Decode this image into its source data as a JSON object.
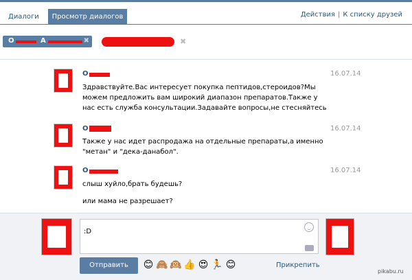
{
  "tabs": {
    "dialogs_label": "Диалоги",
    "view_label": "Просмотр диалогов",
    "actions_label": "Действия",
    "friends_label": "К списку друзей",
    "separator": "|"
  },
  "tokens": {
    "first_letter": "О",
    "second_letter": "А",
    "close_glyph": "✖"
  },
  "messages": [
    {
      "author_initial": "О",
      "date": "16.07.14",
      "text": "Здравствуйте.Вас интересует покупка пептидов,стероидов?Мы можем предложить вам широкий диапазон препаратов.Также у нас есть служба консультации.Задавайте вопросы,не стесняйтесь"
    },
    {
      "author_initial": "О",
      "date": "16.07.14",
      "text": "Также у нас идет распродажа на отдельные препараты,а именно \"метан\" и \"дека-данабол\"."
    },
    {
      "author_initial": "О",
      "date": "16.07.14",
      "text": "слыш хуйло,брать будешь?",
      "text2": "или мама не разрешает?"
    }
  ],
  "compose": {
    "input_value": ":D",
    "send_label": "Отправить",
    "attach_label": "Прикрепить",
    "emojis": [
      "😊",
      "🙈",
      "🙉",
      "👍",
      "😍",
      "🏃",
      "😊"
    ]
  },
  "watermark": "pikabu.ru",
  "colors": {
    "accent": "#597da3",
    "link": "#2b587a",
    "censor": "#ee1111"
  }
}
